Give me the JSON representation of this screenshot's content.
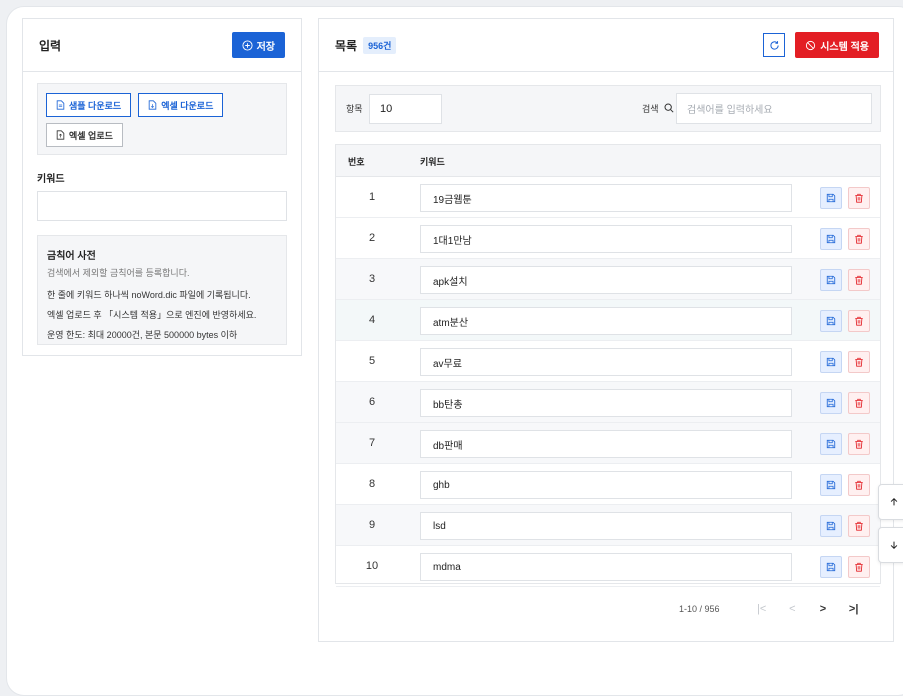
{
  "input_panel": {
    "title": "입력",
    "save_label": "저장",
    "sample_download": "샘플 다운로드",
    "excel_download": "엑셀 다운로드",
    "excel_upload": "엑셀 업로드",
    "keyword_label": "키워드",
    "keyword_value": "",
    "info": {
      "title": "금칙어 사전",
      "subtitle": "검색에서 제외할 금칙어를 등록합니다.",
      "line1": "한 줄에 키워드 하나씩 noWord.dic 파일에 기록됩니다.",
      "line2": "엑셀 업로드 후 「시스템 적용」으로 엔진에 반영하세요.",
      "line3": "운영 한도: 최대 20000건, 본문 500000 bytes 이하"
    }
  },
  "list_panel": {
    "title": "목록",
    "count_badge": "956건",
    "apply_label": "시스템 적용",
    "page_size_label": "항목",
    "page_size_value": "10",
    "search_label": "검색",
    "search_placeholder": "검색어를 입력하세요",
    "col_num": "번호",
    "col_keyword": "키워드",
    "rows": [
      {
        "num": "1",
        "keyword": "19금웹툰"
      },
      {
        "num": "2",
        "keyword": "1대1만남"
      },
      {
        "num": "3",
        "keyword": "apk설치"
      },
      {
        "num": "4",
        "keyword": "atm분산"
      },
      {
        "num": "5",
        "keyword": "av무료"
      },
      {
        "num": "6",
        "keyword": "bb탄총"
      },
      {
        "num": "7",
        "keyword": "db판매"
      },
      {
        "num": "8",
        "keyword": "ghb"
      },
      {
        "num": "9",
        "keyword": "lsd"
      },
      {
        "num": "10",
        "keyword": "mdma"
      }
    ],
    "pagination": {
      "range": "1-10 / 956",
      "first": "|<",
      "prev": "<",
      "next": ">",
      "last": ">|"
    }
  },
  "colors": {
    "primary": "#1b63d6",
    "danger": "#e31e24"
  }
}
